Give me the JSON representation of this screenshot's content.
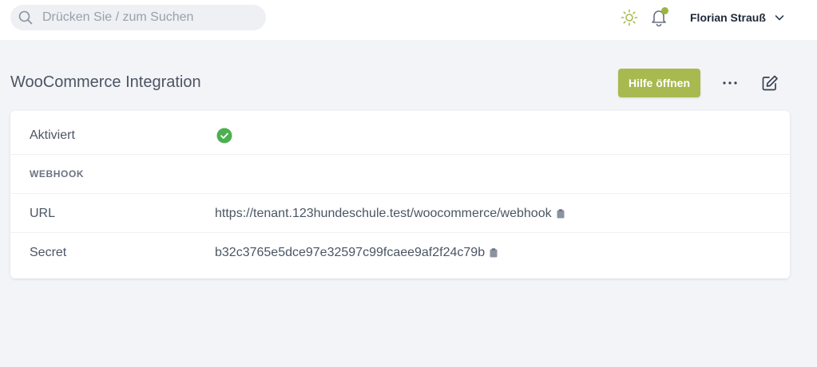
{
  "search": {
    "placeholder": "Drücken Sie / zum Suchen",
    "value": ""
  },
  "header": {
    "theme_icon": "sun-icon",
    "notifications_icon": "bell-icon",
    "user_name": "Florian Strauß"
  },
  "page": {
    "title": "WooCommerce Integration",
    "help_label": "Hilfe öffnen"
  },
  "details": {
    "activated_label": "Aktiviert",
    "activated_status": "check-circle-icon",
    "webhook_section": "WEBHOOK",
    "url_label": "URL",
    "url_value": "https://tenant.123hundeschule.test/woocommerce/webhook",
    "secret_label": "Secret",
    "secret_value": "b32c3765e5dce97e32597c99fcaee9af2f24c79b"
  },
  "colors": {
    "accent": "#a8b94f",
    "success": "#4caf50",
    "notification_dot": "#9bb53c"
  }
}
